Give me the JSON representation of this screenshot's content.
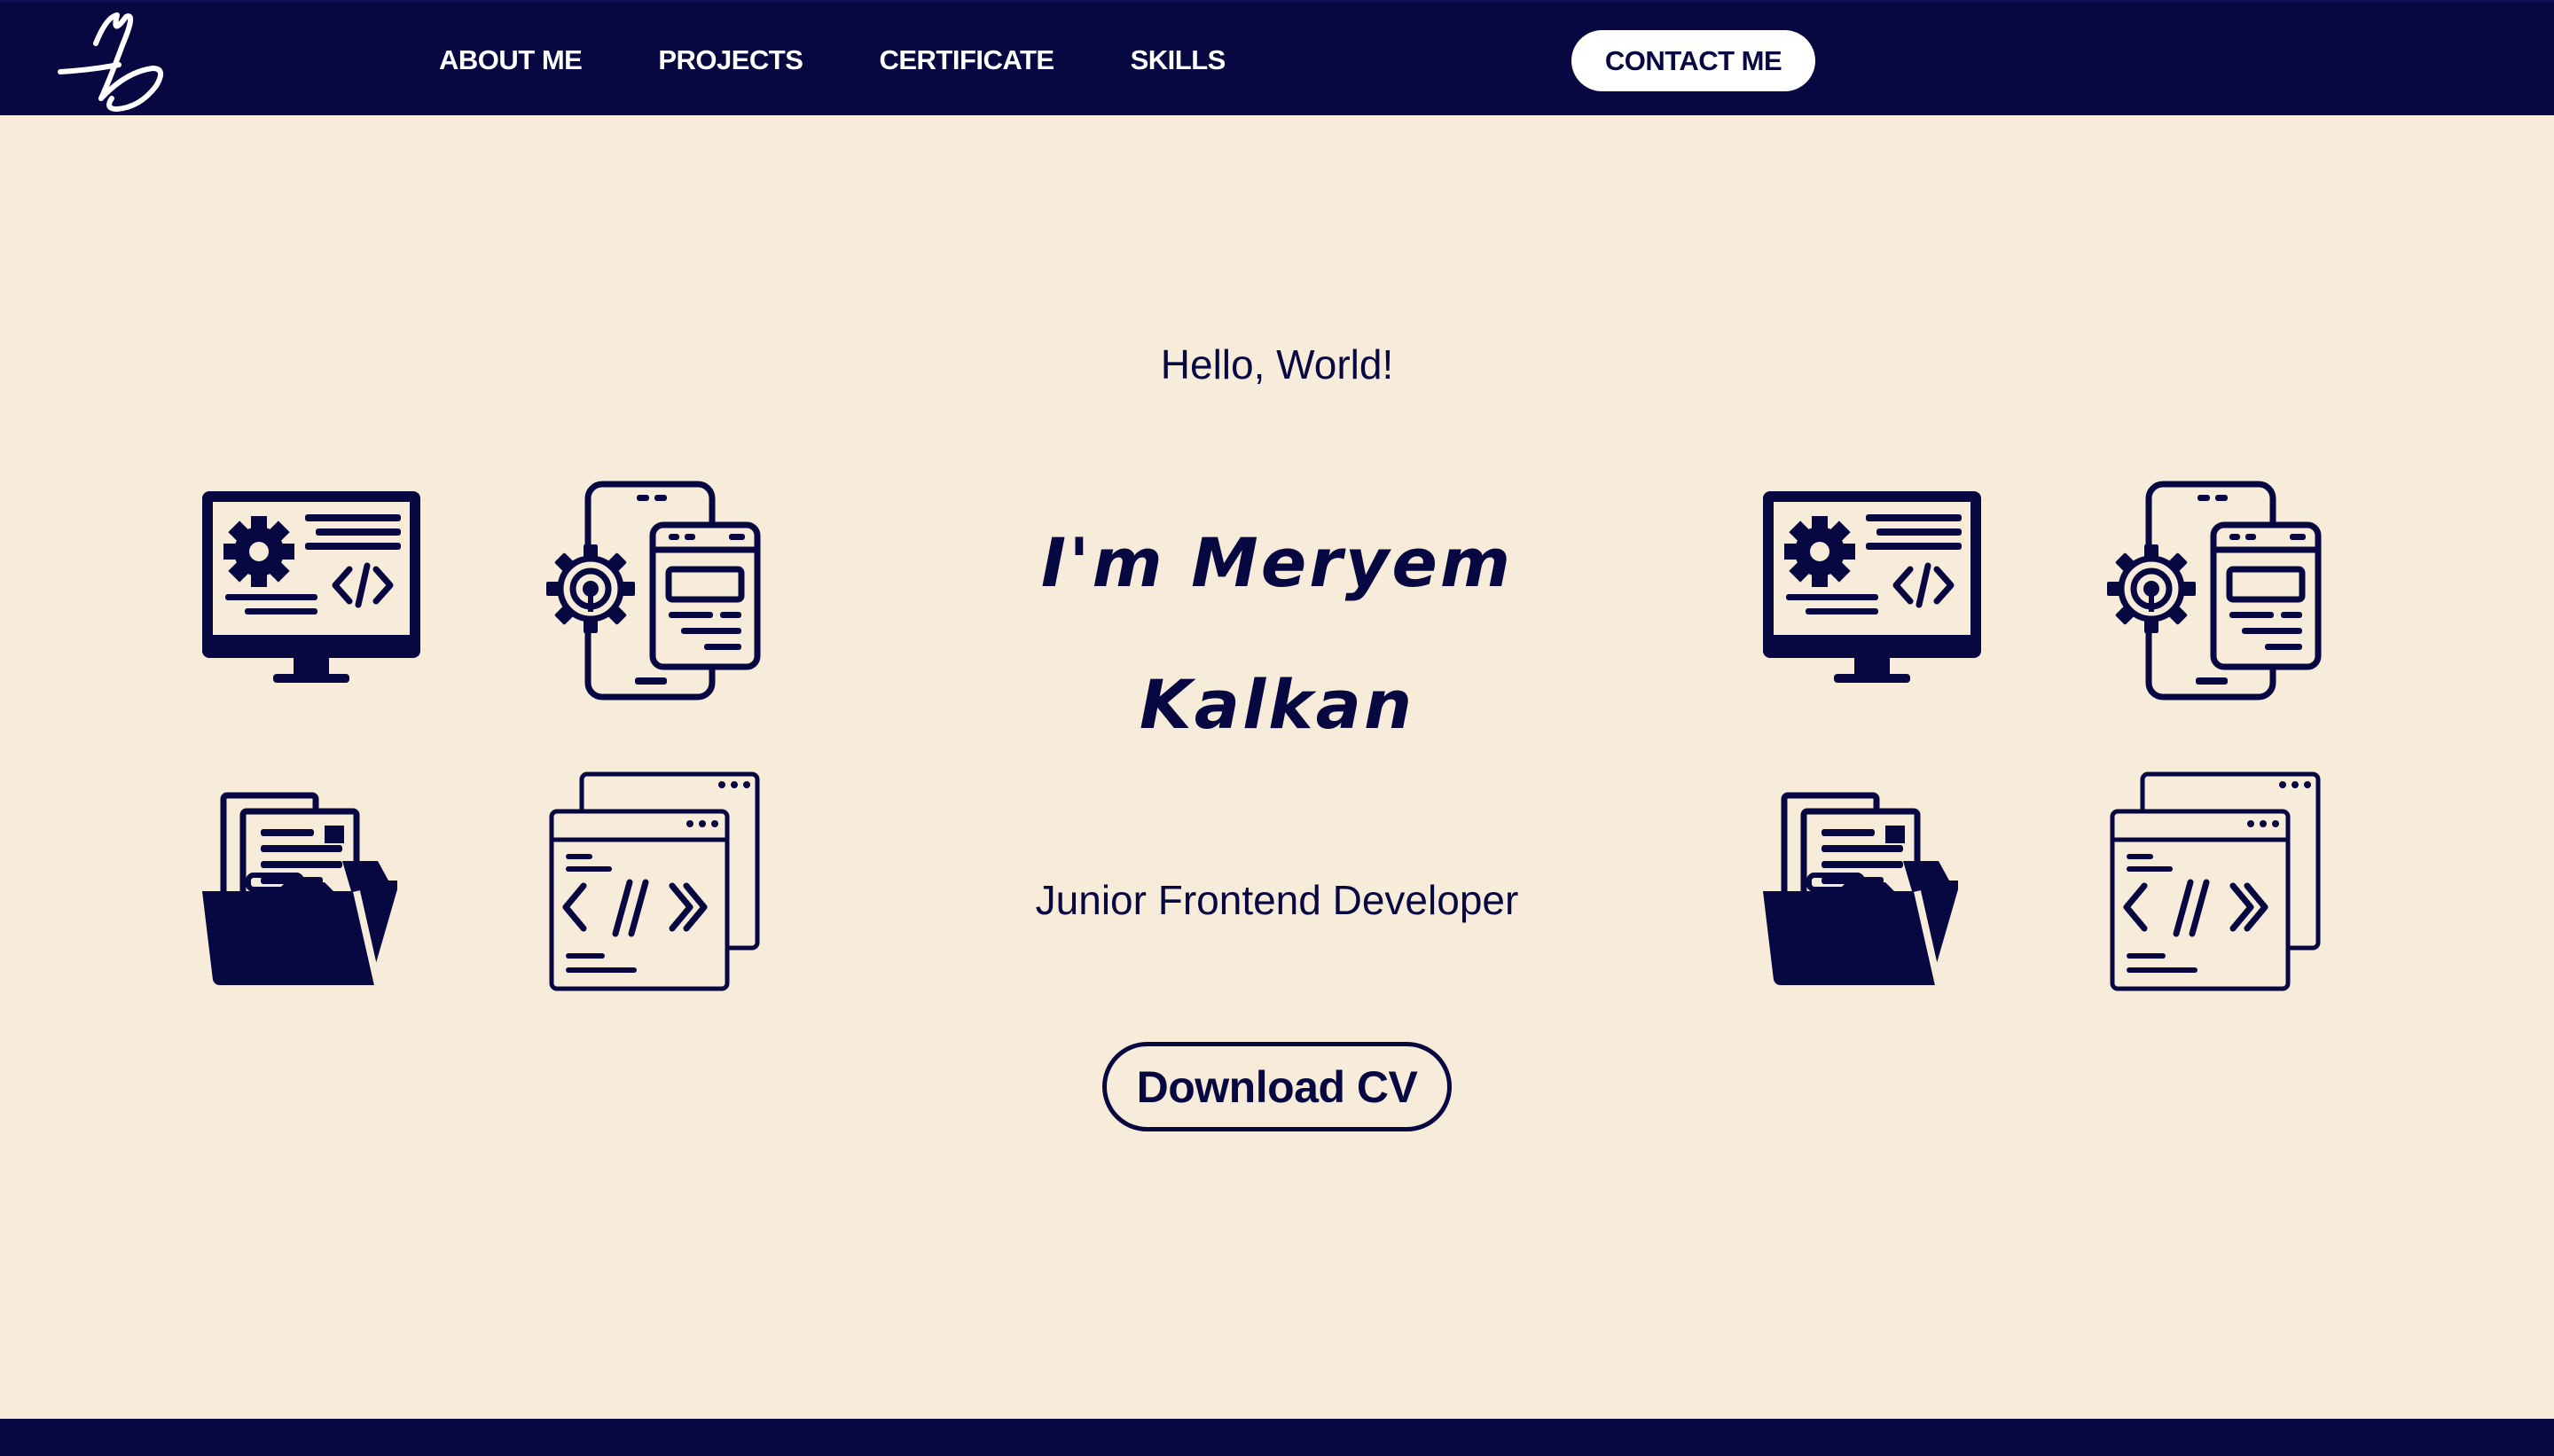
{
  "nav": {
    "logo_icon": "signature-logo-icon",
    "links": [
      {
        "label": "ABOUT ME"
      },
      {
        "label": "PROJECTS"
      },
      {
        "label": "CERTIFICATE"
      },
      {
        "label": "SKILLS"
      }
    ],
    "contact_label": "CONTACT ME"
  },
  "hero": {
    "greeting": "Hello, World!",
    "name_line1": "I'm Meryem",
    "name_line2": "Kalkan",
    "role": "Junior Frontend Developer",
    "cv_label": "Download CV"
  },
  "icons": {
    "left": [
      "monitor-code-icon",
      "mobile-settings-icon",
      "folder-documents-icon",
      "code-window-icon"
    ],
    "right": [
      "monitor-code-icon",
      "mobile-settings-icon",
      "folder-documents-icon",
      "code-window-icon"
    ]
  },
  "colors": {
    "primary": "#070741",
    "background": "#f7ebda",
    "button_bg": "#ffffff"
  }
}
